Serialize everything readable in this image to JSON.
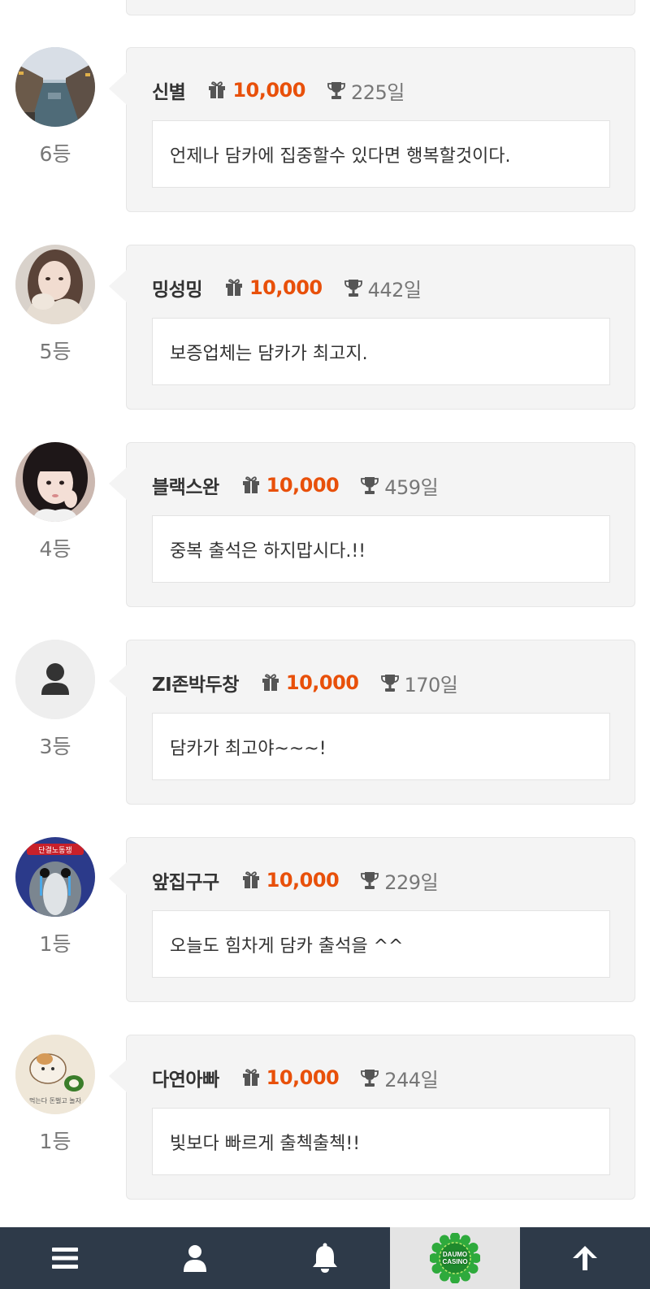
{
  "entries": [
    {
      "nickname": "신별",
      "points": "10,000",
      "days": "225일",
      "rank": "6등",
      "message": "언제나 담카에 집중할수 있다면 행복할것이다.",
      "avatar": "canal-photo"
    },
    {
      "nickname": "밍성밍",
      "points": "10,000",
      "days": "442일",
      "rank": "5등",
      "message": "보증업체는 담카가 최고지.",
      "avatar": "girl-photo"
    },
    {
      "nickname": "블랙스완",
      "points": "10,000",
      "days": "459일",
      "rank": "4등",
      "message": "중복 출석은 하지맙시다.!!",
      "avatar": "girl-selfie"
    },
    {
      "nickname": "ZI존박두창",
      "points": "10,000",
      "days": "170일",
      "rank": "3등",
      "message": "담카가 최고야~~~!",
      "avatar": "default-user-icon"
    },
    {
      "nickname": "앞집구구",
      "points": "10,000",
      "days": "229일",
      "rank": "1등",
      "message": "오늘도 힘차게 담카 출석을 ^^",
      "avatar": "cartoon-bird"
    },
    {
      "nickname": "다연아빠",
      "points": "10,000",
      "days": "244일",
      "rank": "1등",
      "message": "빛보다 빠르게 출첵출첵!!",
      "avatar": "cartoon-hamster"
    }
  ],
  "bottom_nav": {
    "items": [
      "menu-icon",
      "user-icon",
      "bell-icon",
      "casino-logo",
      "arrow-up-icon"
    ],
    "logo_text_line1": "DAUMO",
    "logo_text_line2": "CASINO"
  },
  "colors": {
    "points": "#e8500a",
    "card_bg": "#f4f4f4",
    "nav_bg": "#2e3a49",
    "logo_green": "#2eaa3c"
  }
}
